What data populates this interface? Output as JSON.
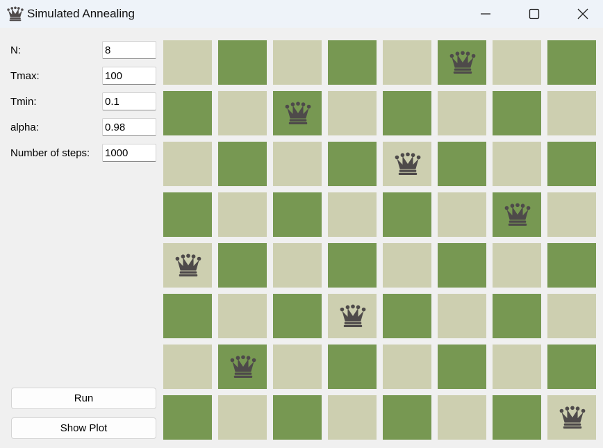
{
  "window": {
    "title": "Simulated Annealing",
    "icon": "chess-queen-icon"
  },
  "params": {
    "n_label": "N:",
    "n_value": "8",
    "tmax_label": "Tmax:",
    "tmax_value": "100",
    "tmin_label": "Tmin:",
    "tmin_value": "0.1",
    "alpha_label": "alpha:",
    "alpha_value": "0.98",
    "steps_label": "Number of steps:",
    "steps_value": "1000"
  },
  "buttons": {
    "run_label": "Run",
    "plot_label": "Show Plot"
  },
  "board": {
    "size": 8,
    "light_color": "#cdcfb0",
    "dark_color": "#779852",
    "queen_color": "#4e4a4a",
    "queen_icon": "chess-queen-icon",
    "queen_columns_by_row": [
      5,
      2,
      4,
      6,
      0,
      3,
      1,
      7
    ]
  }
}
